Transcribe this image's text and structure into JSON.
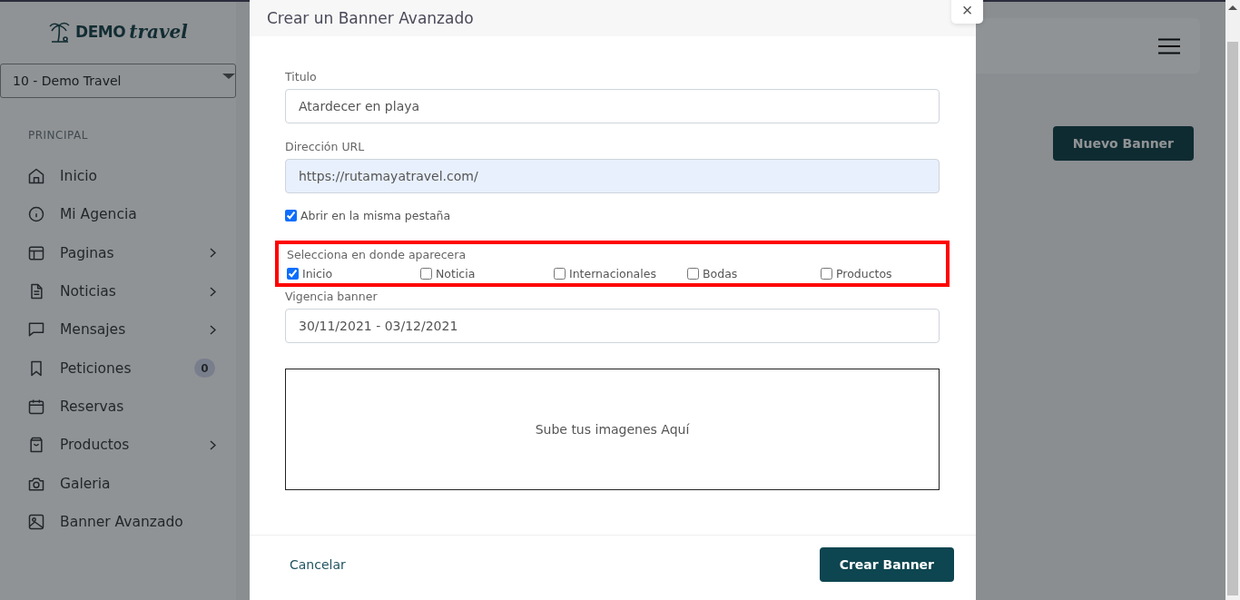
{
  "sidebar": {
    "logo": {
      "word_1": "DEMO",
      "word_2": "travel"
    },
    "agency_select": {
      "value": "10 - Demo Travel"
    },
    "section_label": "PRINCIPAL",
    "items": [
      {
        "label": "Inicio",
        "expandable": false
      },
      {
        "label": "Mi Agencia",
        "expandable": false
      },
      {
        "label": "Paginas",
        "expandable": true
      },
      {
        "label": "Noticias",
        "expandable": true
      },
      {
        "label": "Mensajes",
        "expandable": true
      },
      {
        "label": "Peticiones",
        "expandable": false,
        "badge": "0"
      },
      {
        "label": "Reservas",
        "expandable": false
      },
      {
        "label": "Productos",
        "expandable": true
      },
      {
        "label": "Galeria",
        "expandable": false
      },
      {
        "label": "Banner Avanzado",
        "expandable": false
      }
    ]
  },
  "main": {
    "new_button": "Nuevo Banner"
  },
  "modal": {
    "title": "Crear un Banner Avanzado",
    "close": "×",
    "title_field": {
      "label": "Titulo",
      "value": "Atardecer en playa"
    },
    "url_field": {
      "label": "Dirección URL",
      "value": "https://rutamayatravel.com/",
      "autofilled": true
    },
    "same_tab": {
      "label": "Abrir en la misma pestaña",
      "checked": true
    },
    "placement": {
      "label": "Selecciona en donde aparecera",
      "highlighted": true,
      "options": [
        {
          "label": "Inicio",
          "checked": true
        },
        {
          "label": "Noticia",
          "checked": false
        },
        {
          "label": "Internacionales",
          "checked": false
        },
        {
          "label": "Bodas",
          "checked": false
        },
        {
          "label": "Productos",
          "checked": false
        }
      ]
    },
    "validity_field": {
      "label": "Vigencia banner",
      "value": "30/11/2021 - 03/12/2021"
    },
    "upload": {
      "text": "Sube tus imagenes Aquí"
    },
    "cancel": "Cancelar",
    "submit": "Crear Banner"
  }
}
